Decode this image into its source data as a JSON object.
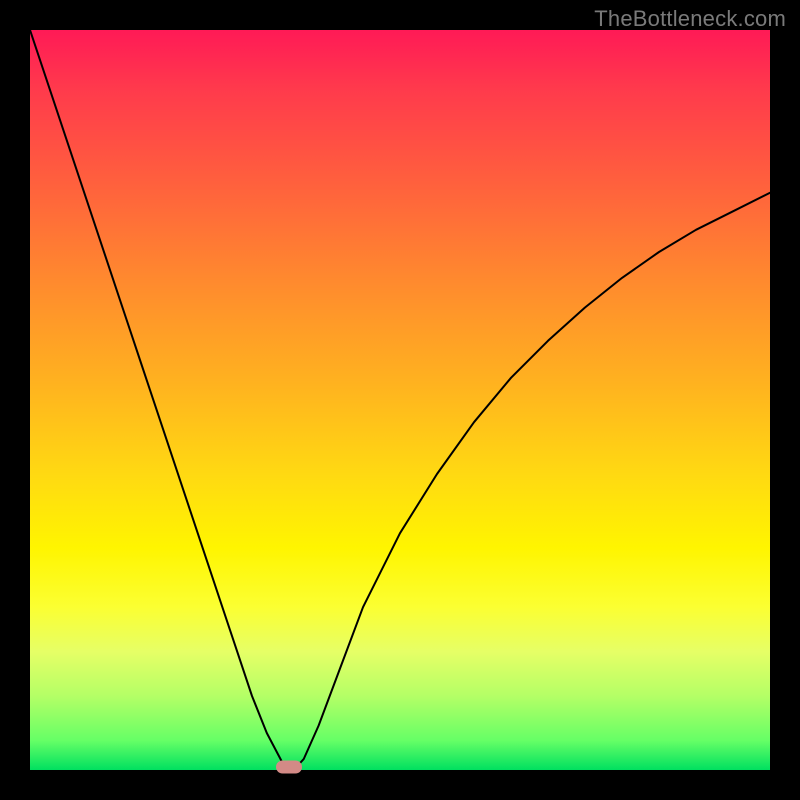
{
  "watermark": "TheBottleneck.com",
  "chart_data": {
    "type": "line",
    "title": "",
    "xlabel": "",
    "ylabel": "",
    "xlim": [
      0,
      100
    ],
    "ylim": [
      0,
      100
    ],
    "grid": false,
    "legend": false,
    "series": [
      {
        "name": "curve",
        "x": [
          0,
          3,
          6,
          9,
          12,
          15,
          18,
          21,
          24,
          27,
          30,
          32,
          34,
          35,
          36,
          37,
          39,
          42,
          45,
          50,
          55,
          60,
          65,
          70,
          75,
          80,
          85,
          90,
          95,
          100
        ],
        "y": [
          100,
          91,
          82,
          73,
          64,
          55,
          46,
          37,
          28,
          19,
          10,
          5,
          1.2,
          0.4,
          0.4,
          1.5,
          6,
          14,
          22,
          32,
          40,
          47,
          53,
          58,
          62.5,
          66.5,
          70,
          73,
          75.5,
          78
        ]
      }
    ],
    "marker": {
      "x": 35,
      "y": 0.4
    },
    "background_gradient": [
      "#ff1a56",
      "#ffd912",
      "#fff500",
      "#00e060"
    ]
  }
}
